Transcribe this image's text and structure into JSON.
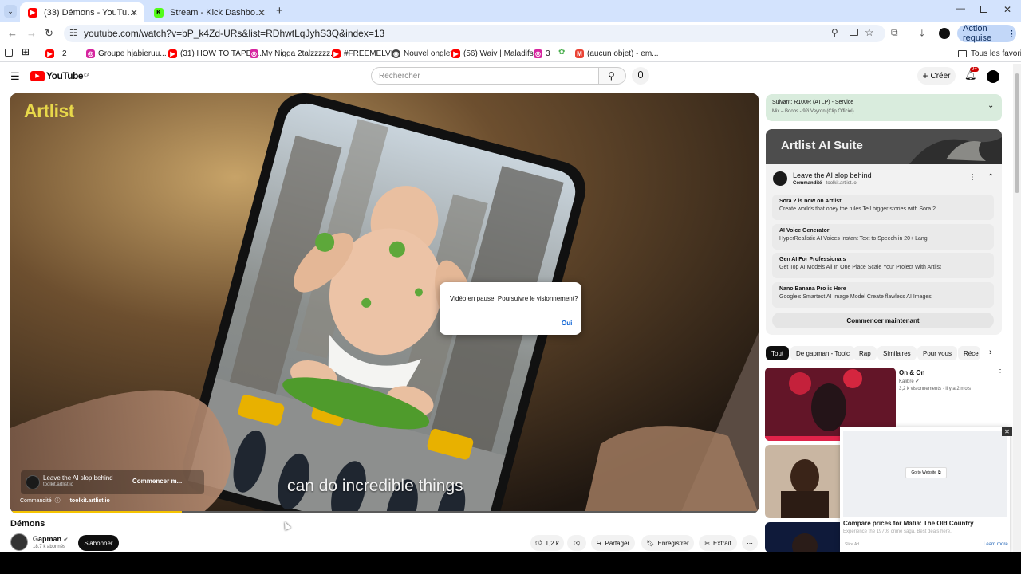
{
  "browser": {
    "tabs": [
      {
        "title": "(33) Démons - YouTube",
        "favicon": "youtube-icon",
        "active": true
      },
      {
        "title": "Stream - Kick Dashboard",
        "favicon": "kick-icon",
        "active": false
      }
    ],
    "url": "youtube.com/watch?v=bP_k4Zd-URs&list=RDhwtLqJyhS3Q&index=13",
    "action_label": "Action requise",
    "bookmarks": [
      {
        "label": "2",
        "icon": "youtube-icon"
      },
      {
        "label": "Groupe hjabieruu...",
        "icon": "instagram-icon"
      },
      {
        "label": "(31) HOW TO TAPER...",
        "icon": "youtube-icon"
      },
      {
        "label": "My Nigga 2talzzzzz...",
        "icon": "instagram-icon"
      },
      {
        "label": "#FREEMELVIN",
        "icon": "youtube-icon"
      },
      {
        "label": "Nouvel onglet",
        "icon": "chrome-icon"
      },
      {
        "label": "(56) Waiv | Maladifs...",
        "icon": "youtube-icon"
      },
      {
        "label": "3",
        "icon": "instagram-icon"
      },
      {
        "label": "(aucun objet) - em...",
        "icon": "gmail-icon"
      }
    ],
    "all_bookmarks": "Tous les favoris"
  },
  "youtube": {
    "logo_text": "YouTube",
    "logo_region": "CA",
    "search_placeholder": "Rechercher",
    "create_label": "Créer",
    "notif_count": "9+"
  },
  "player": {
    "brand_logo": "Artlist",
    "caption": "can do incredible things",
    "ad_title": "Leave the AI slop behind",
    "ad_domain": "toolkit.artlist.io",
    "ad_cta": "Commencer m...",
    "sponsored": "Commandité",
    "sponsored_domain": "toolkit.artlist.io",
    "dialog_message": "Vidéo en pause. Poursuivre le visionnement?",
    "dialog_button": "Oui"
  },
  "video": {
    "title": "Démons",
    "channel": "Gapman",
    "subscribers": "18,7 k abonnés",
    "subscribe_label": "S'abonner",
    "likes": "1,2 k",
    "share_label": "Partager",
    "save_label": "Enregistrer",
    "clip_label": "Extrait"
  },
  "sidebar": {
    "up_next_title": "Suivant: R100R (ATLP) - Service",
    "up_next_sub": "Mix – Boobs - 92i Veyron (Clip Officiel)",
    "ad": {
      "banner_title": "Artlist AI Suite",
      "title": "Leave the AI slop behind",
      "sponsored": "Commandité",
      "domain": "toolkit.artlist.io",
      "items": [
        {
          "title": "Sora 2 is now on Artlist",
          "desc": "Create worlds that obey the rules Tell bigger stories with Sora 2"
        },
        {
          "title": "AI Voice Generator",
          "desc": "HyperRealistic AI Voices Instant Text to Speech in 20+ Lang."
        },
        {
          "title": "Gen AI For Professionals",
          "desc": "Get Top AI Models All In One Place Scale Your Project With Artlist"
        },
        {
          "title": "Nano Banana Pro is Here",
          "desc": "Google's Smartest AI Image Model Create flawless AI Images"
        }
      ],
      "cta": "Commencer maintenant"
    },
    "chips": [
      "Tout",
      "De gapman - Topic",
      "Rap",
      "Similaires",
      "Pour vous",
      "Réce"
    ],
    "videos": [
      {
        "title": "On & On",
        "channel": "Kalibre",
        "meta": "3,2 k visionnements · il y a 2 mois"
      }
    ]
  },
  "popup_ad": {
    "go_label": "Go to Website",
    "title": "Compare prices for Mafia: The Old Country",
    "desc": "Experience the 1970s crime saga. Best deals here.",
    "tag": "Slice Ad",
    "learn_more": "Learn more"
  },
  "colors": {
    "youtube_red": "#ff0000",
    "artlist_yellow": "#e8d84a",
    "upnext_bg": "#d9ecdd",
    "chrome_tabbar": "#d3e3fd",
    "dialog_link": "#065fd4"
  }
}
